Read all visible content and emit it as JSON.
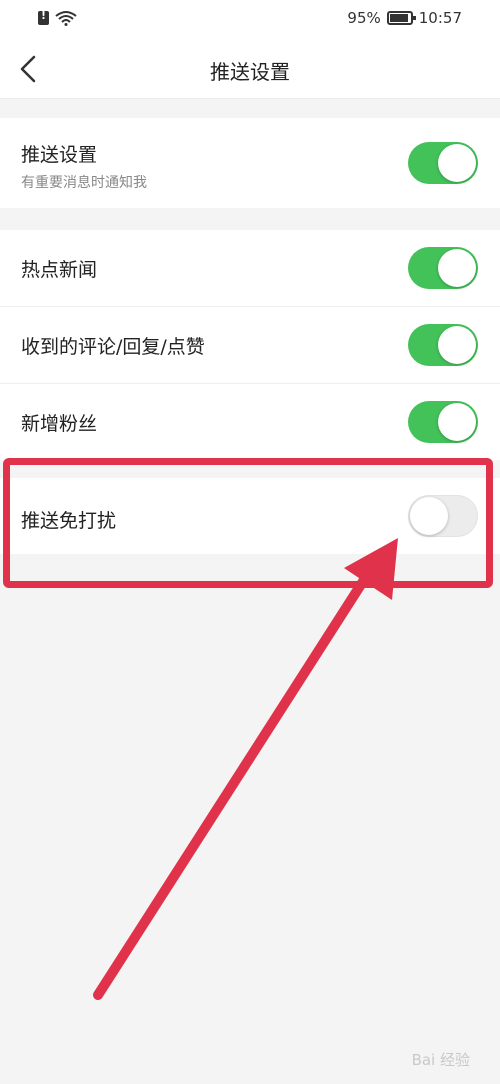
{
  "status_bar": {
    "battery_percent": "95%",
    "time": "10:57",
    "icons": [
      "sim-alert-icon",
      "wifi-icon",
      "battery-icon"
    ]
  },
  "nav": {
    "back_icon": "chevron-left-icon",
    "title": "推送设置"
  },
  "master": {
    "label": "推送设置",
    "sub": "有重要消息时通知我",
    "on": true
  },
  "items": [
    {
      "label": "热点新闻",
      "on": true
    },
    {
      "label": "收到的评论/回复/点赞",
      "on": true
    },
    {
      "label": "新增粉丝",
      "on": true
    }
  ],
  "dnd": {
    "label": "推送免打扰",
    "on": false
  },
  "watermark": "Bai 经验",
  "colors": {
    "toggle_on": "#43c25a",
    "toggle_off": "#ececec",
    "annotation": "#e0334b"
  }
}
